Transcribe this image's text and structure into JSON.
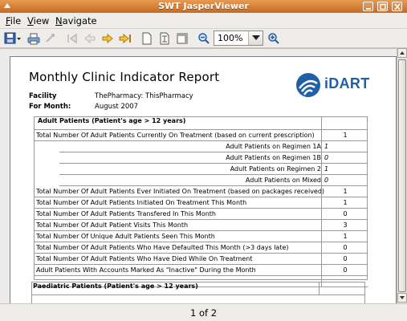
{
  "window": {
    "title": "SWT JasperViewer"
  },
  "menu": [
    {
      "mnemonic": "F",
      "rest": "ile"
    },
    {
      "mnemonic": "V",
      "rest": "iew"
    },
    {
      "mnemonic": "N",
      "rest": "avigate"
    }
  ],
  "toolbar": {
    "zoom": "100%"
  },
  "report": {
    "title": "Monthly Clinic Indicator Report",
    "facility_label": "Facility",
    "facility_value": "ThePharmacy: ThisPharmacy",
    "month_label": "For Month:",
    "month_value": "August 2007",
    "logo_text": "iDART",
    "adult_section": "Adult Patients (Patient's age > 12 years)",
    "adult_rows": [
      {
        "label": "Total Number Of Adult Patients Currently On Treatment (based on current prescription)",
        "value": "1",
        "indent": false
      },
      {
        "label": "Adult Patients on Regimen 1A",
        "value": "1",
        "indent": true
      },
      {
        "label": "Adult Patients on Regimen 1B",
        "value": "0",
        "indent": true
      },
      {
        "label": "Adult Patients on Regimen 2",
        "value": "1",
        "indent": true
      },
      {
        "label": "Adult Patients on Mixed",
        "value": "0",
        "indent": true
      },
      {
        "label": "Total Number Of Adult Patients Ever Initiated On Treatment (based on packages received)",
        "value": "1",
        "indent": false
      },
      {
        "label": "Total Number Of Adult Patients Initiated On Treatment This Month",
        "value": "1",
        "indent": false
      },
      {
        "label": "Total Number Of Adult Patients Transfered In This Month",
        "value": "0",
        "indent": false
      },
      {
        "label": "Total Number Of Adult Patient Visits This Month",
        "value": "3",
        "indent": false
      },
      {
        "label": "Total Number Of Unique Adult Patients Seen This Month",
        "value": "1",
        "indent": false
      },
      {
        "label": "Total Number Of Adult Patients Who Have Defaulted This Month  (>3 days late)",
        "value": "0",
        "indent": false
      },
      {
        "label": "Total Number Of Adult Patients Who Have Died While On Treatment",
        "value": "0",
        "indent": false
      },
      {
        "label": "Adult Patients With Accounts Marked As \"Inactive\" During the Month",
        "value": "0",
        "indent": false
      }
    ],
    "paed_section": "Paediatric Patients (Patient's age > 12 years)"
  },
  "status": {
    "page_indicator": "1 of 2"
  }
}
